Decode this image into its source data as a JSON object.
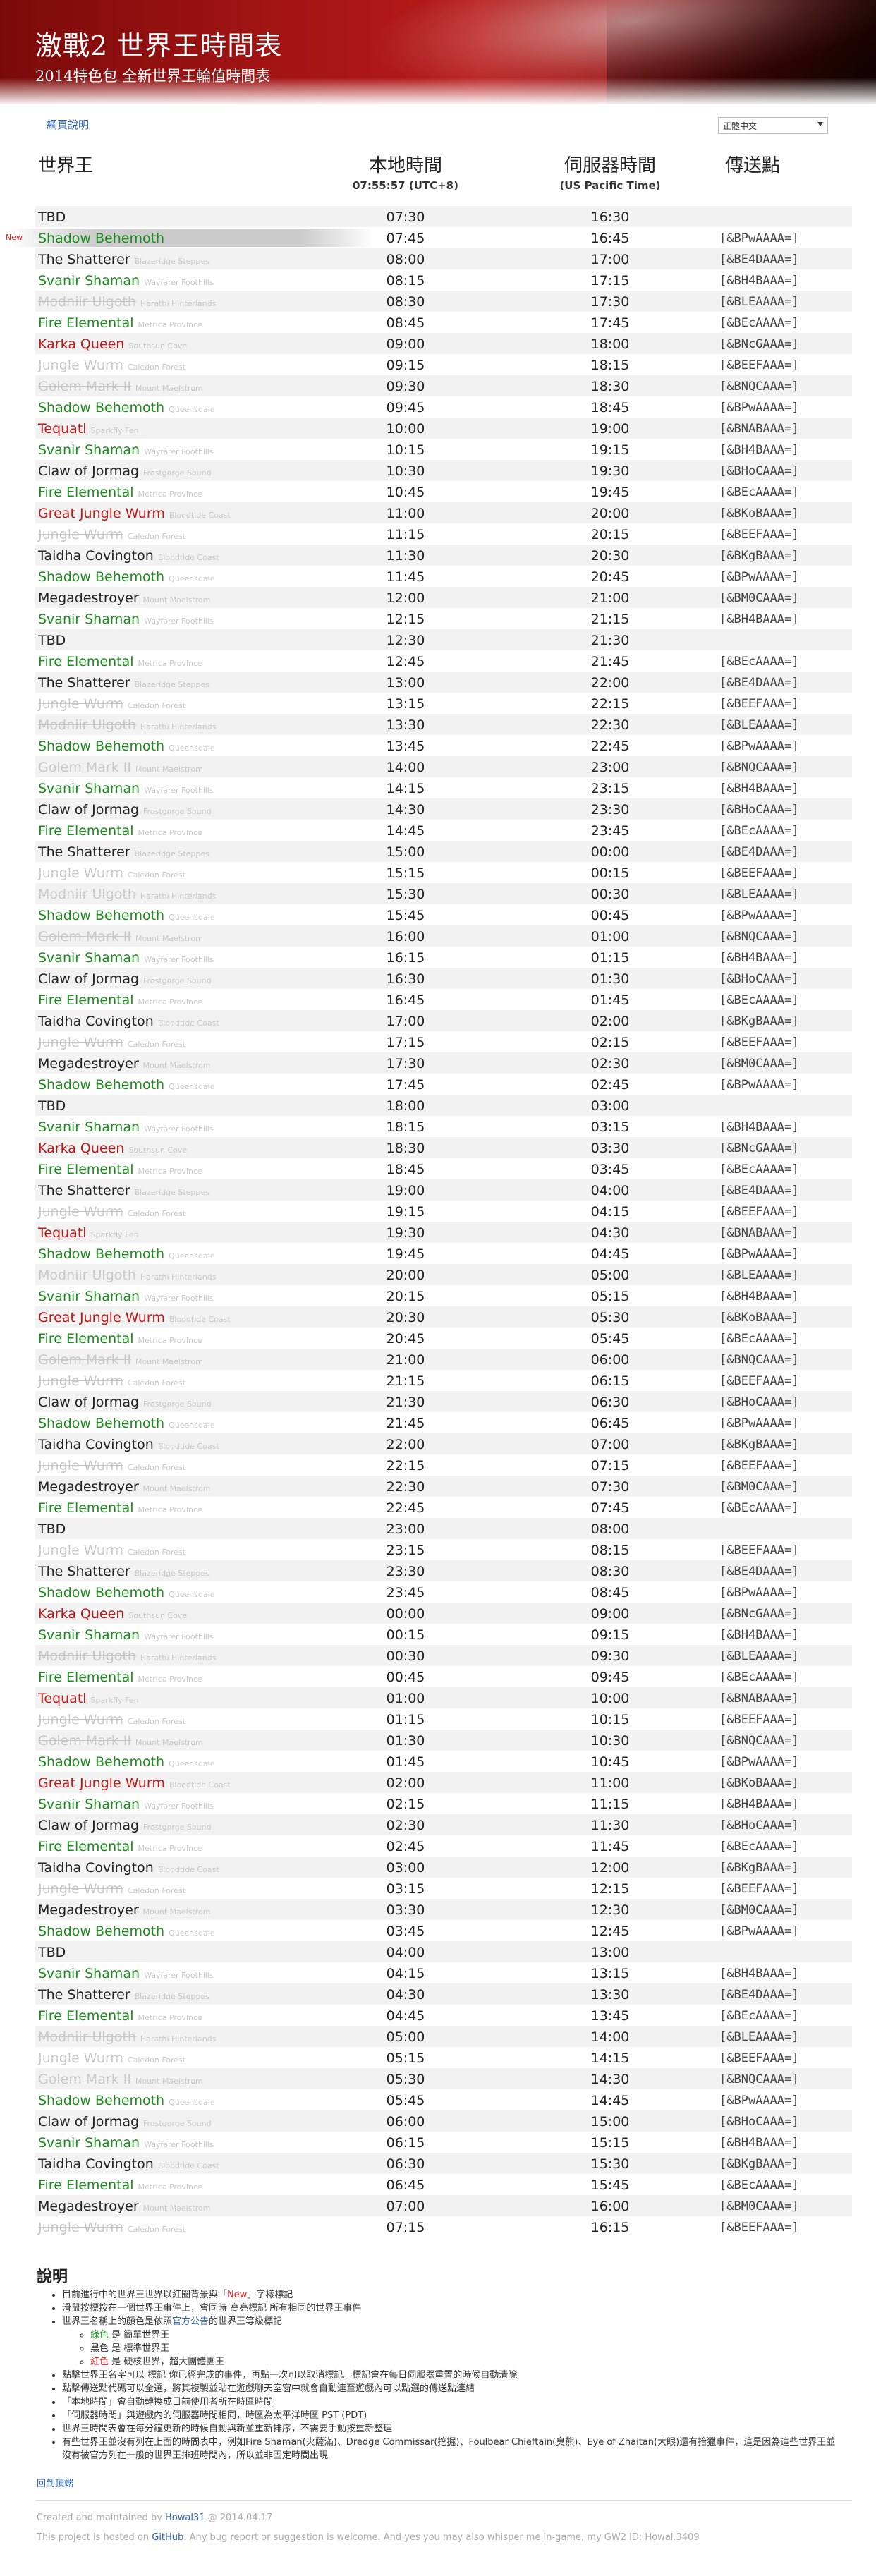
{
  "header": {
    "title": "激戰2 世界王時間表",
    "subtitle": "2014特色包 全新世界王輪值時間表"
  },
  "toolbar": {
    "help_link": "網頁說明",
    "language": "正體中文"
  },
  "columns": {
    "boss": "世界王",
    "local": "本地時間",
    "local_sub": "07:55:57 (UTC+8)",
    "server": "伺服器時間",
    "server_sub": "(US Pacific Time)",
    "waypoint": "傳送點"
  },
  "rows": [
    {
      "name": "TBD",
      "loc": "",
      "lt": "07:30",
      "st": "16:30",
      "wp": "",
      "c": "black"
    },
    {
      "name": "Shadow Behemoth",
      "loc": "",
      "lt": "07:45",
      "st": "16:45",
      "wp": "[&BPwAAAA=]",
      "c": "green",
      "new": "New"
    },
    {
      "name": "The Shatterer",
      "loc": "Blazeridge Steppes",
      "lt": "08:00",
      "st": "17:00",
      "wp": "[&BE4DAAA=]",
      "c": "black"
    },
    {
      "name": "Svanir Shaman",
      "loc": "Wayfarer Foothills",
      "lt": "08:15",
      "st": "17:15",
      "wp": "[&BH4BAAA=]",
      "c": "green"
    },
    {
      "name": "Modniir Ulgoth",
      "loc": "Harathi Hinterlands",
      "lt": "08:30",
      "st": "17:30",
      "wp": "[&BLEAAAA=]",
      "c": "gone"
    },
    {
      "name": "Fire Elemental",
      "loc": "Metrica Province",
      "lt": "08:45",
      "st": "17:45",
      "wp": "[&BEcAAAA=]",
      "c": "green"
    },
    {
      "name": "Karka Queen",
      "loc": "Southsun Cove",
      "lt": "09:00",
      "st": "18:00",
      "wp": "[&BNcGAAA=]",
      "c": "red"
    },
    {
      "name": "Jungle Wurm",
      "loc": "Caledon Forest",
      "lt": "09:15",
      "st": "18:15",
      "wp": "[&BEEFAAA=]",
      "c": "gone"
    },
    {
      "name": "Golem Mark II",
      "loc": "Mount Maelstrom",
      "lt": "09:30",
      "st": "18:30",
      "wp": "[&BNQCAAA=]",
      "c": "gone"
    },
    {
      "name": "Shadow Behemoth",
      "loc": "Queensdale",
      "lt": "09:45",
      "st": "18:45",
      "wp": "[&BPwAAAA=]",
      "c": "green"
    },
    {
      "name": "Tequatl",
      "loc": "Sparkfly Fen",
      "lt": "10:00",
      "st": "19:00",
      "wp": "[&BNABAAA=]",
      "c": "red"
    },
    {
      "name": "Svanir Shaman",
      "loc": "Wayfarer Foothills",
      "lt": "10:15",
      "st": "19:15",
      "wp": "[&BH4BAAA=]",
      "c": "green"
    },
    {
      "name": "Claw of Jormag",
      "loc": "Frostgorge Sound",
      "lt": "10:30",
      "st": "19:30",
      "wp": "[&BHoCAAA=]",
      "c": "black"
    },
    {
      "name": "Fire Elemental",
      "loc": "Metrica Province",
      "lt": "10:45",
      "st": "19:45",
      "wp": "[&BEcAAAA=]",
      "c": "green"
    },
    {
      "name": "Great Jungle Wurm",
      "loc": "Bloodtide Coast",
      "lt": "11:00",
      "st": "20:00",
      "wp": "[&BKoBAAA=]",
      "c": "red"
    },
    {
      "name": "Jungle Wurm",
      "loc": "Caledon Forest",
      "lt": "11:15",
      "st": "20:15",
      "wp": "[&BEEFAAA=]",
      "c": "gone"
    },
    {
      "name": "Taidha Covington",
      "loc": "Bloodtide Coast",
      "lt": "11:30",
      "st": "20:30",
      "wp": "[&BKgBAAA=]",
      "c": "black"
    },
    {
      "name": "Shadow Behemoth",
      "loc": "Queensdale",
      "lt": "11:45",
      "st": "20:45",
      "wp": "[&BPwAAAA=]",
      "c": "green"
    },
    {
      "name": "Megadestroyer",
      "loc": "Mount Maelstrom",
      "lt": "12:00",
      "st": "21:00",
      "wp": "[&BM0CAAA=]",
      "c": "black"
    },
    {
      "name": "Svanir Shaman",
      "loc": "Wayfarer Foothills",
      "lt": "12:15",
      "st": "21:15",
      "wp": "[&BH4BAAA=]",
      "c": "green"
    },
    {
      "name": "TBD",
      "loc": "",
      "lt": "12:30",
      "st": "21:30",
      "wp": "",
      "c": "black"
    },
    {
      "name": "Fire Elemental",
      "loc": "Metrica Province",
      "lt": "12:45",
      "st": "21:45",
      "wp": "[&BEcAAAA=]",
      "c": "green"
    },
    {
      "name": "The Shatterer",
      "loc": "Blazeridge Steppes",
      "lt": "13:00",
      "st": "22:00",
      "wp": "[&BE4DAAA=]",
      "c": "black"
    },
    {
      "name": "Jungle Wurm",
      "loc": "Caledon Forest",
      "lt": "13:15",
      "st": "22:15",
      "wp": "[&BEEFAAA=]",
      "c": "gone"
    },
    {
      "name": "Modniir Ulgoth",
      "loc": "Harathi Hinterlands",
      "lt": "13:30",
      "st": "22:30",
      "wp": "[&BLEAAAA=]",
      "c": "gone"
    },
    {
      "name": "Shadow Behemoth",
      "loc": "Queensdale",
      "lt": "13:45",
      "st": "22:45",
      "wp": "[&BPwAAAA=]",
      "c": "green"
    },
    {
      "name": "Golem Mark II",
      "loc": "Mount Maelstrom",
      "lt": "14:00",
      "st": "23:00",
      "wp": "[&BNQCAAA=]",
      "c": "gone"
    },
    {
      "name": "Svanir Shaman",
      "loc": "Wayfarer Foothills",
      "lt": "14:15",
      "st": "23:15",
      "wp": "[&BH4BAAA=]",
      "c": "green"
    },
    {
      "name": "Claw of Jormag",
      "loc": "Frostgorge Sound",
      "lt": "14:30",
      "st": "23:30",
      "wp": "[&BHoCAAA=]",
      "c": "black"
    },
    {
      "name": "Fire Elemental",
      "loc": "Metrica Province",
      "lt": "14:45",
      "st": "23:45",
      "wp": "[&BEcAAAA=]",
      "c": "green"
    },
    {
      "name": "The Shatterer",
      "loc": "Blazeridge Steppes",
      "lt": "15:00",
      "st": "00:00",
      "wp": "[&BE4DAAA=]",
      "c": "black"
    },
    {
      "name": "Jungle Wurm",
      "loc": "Caledon Forest",
      "lt": "15:15",
      "st": "00:15",
      "wp": "[&BEEFAAA=]",
      "c": "gone"
    },
    {
      "name": "Modniir Ulgoth",
      "loc": "Harathi Hinterlands",
      "lt": "15:30",
      "st": "00:30",
      "wp": "[&BLEAAAA=]",
      "c": "gone"
    },
    {
      "name": "Shadow Behemoth",
      "loc": "Queensdale",
      "lt": "15:45",
      "st": "00:45",
      "wp": "[&BPwAAAA=]",
      "c": "green"
    },
    {
      "name": "Golem Mark II",
      "loc": "Mount Maelstrom",
      "lt": "16:00",
      "st": "01:00",
      "wp": "[&BNQCAAA=]",
      "c": "gone"
    },
    {
      "name": "Svanir Shaman",
      "loc": "Wayfarer Foothills",
      "lt": "16:15",
      "st": "01:15",
      "wp": "[&BH4BAAA=]",
      "c": "green"
    },
    {
      "name": "Claw of Jormag",
      "loc": "Frostgorge Sound",
      "lt": "16:30",
      "st": "01:30",
      "wp": "[&BHoCAAA=]",
      "c": "black"
    },
    {
      "name": "Fire Elemental",
      "loc": "Metrica Province",
      "lt": "16:45",
      "st": "01:45",
      "wp": "[&BEcAAAA=]",
      "c": "green"
    },
    {
      "name": "Taidha Covington",
      "loc": "Bloodtide Coast",
      "lt": "17:00",
      "st": "02:00",
      "wp": "[&BKgBAAA=]",
      "c": "black"
    },
    {
      "name": "Jungle Wurm",
      "loc": "Caledon Forest",
      "lt": "17:15",
      "st": "02:15",
      "wp": "[&BEEFAAA=]",
      "c": "gone"
    },
    {
      "name": "Megadestroyer",
      "loc": "Mount Maelstrom",
      "lt": "17:30",
      "st": "02:30",
      "wp": "[&BM0CAAA=]",
      "c": "black"
    },
    {
      "name": "Shadow Behemoth",
      "loc": "Queensdale",
      "lt": "17:45",
      "st": "02:45",
      "wp": "[&BPwAAAA=]",
      "c": "green"
    },
    {
      "name": "TBD",
      "loc": "",
      "lt": "18:00",
      "st": "03:00",
      "wp": "",
      "c": "black"
    },
    {
      "name": "Svanir Shaman",
      "loc": "Wayfarer Foothills",
      "lt": "18:15",
      "st": "03:15",
      "wp": "[&BH4BAAA=]",
      "c": "green"
    },
    {
      "name": "Karka Queen",
      "loc": "Southsun Cove",
      "lt": "18:30",
      "st": "03:30",
      "wp": "[&BNcGAAA=]",
      "c": "red"
    },
    {
      "name": "Fire Elemental",
      "loc": "Metrica Province",
      "lt": "18:45",
      "st": "03:45",
      "wp": "[&BEcAAAA=]",
      "c": "green"
    },
    {
      "name": "The Shatterer",
      "loc": "Blazeridge Steppes",
      "lt": "19:00",
      "st": "04:00",
      "wp": "[&BE4DAAA=]",
      "c": "black"
    },
    {
      "name": "Jungle Wurm",
      "loc": "Caledon Forest",
      "lt": "19:15",
      "st": "04:15",
      "wp": "[&BEEFAAA=]",
      "c": "gone"
    },
    {
      "name": "Tequatl",
      "loc": "Sparkfly Fen",
      "lt": "19:30",
      "st": "04:30",
      "wp": "[&BNABAAA=]",
      "c": "red"
    },
    {
      "name": "Shadow Behemoth",
      "loc": "Queensdale",
      "lt": "19:45",
      "st": "04:45",
      "wp": "[&BPwAAAA=]",
      "c": "green"
    },
    {
      "name": "Modniir Ulgoth",
      "loc": "Harathi Hinterlands",
      "lt": "20:00",
      "st": "05:00",
      "wp": "[&BLEAAAA=]",
      "c": "gone"
    },
    {
      "name": "Svanir Shaman",
      "loc": "Wayfarer Foothills",
      "lt": "20:15",
      "st": "05:15",
      "wp": "[&BH4BAAA=]",
      "c": "green"
    },
    {
      "name": "Great Jungle Wurm",
      "loc": "Bloodtide Coast",
      "lt": "20:30",
      "st": "05:30",
      "wp": "[&BKoBAAA=]",
      "c": "red"
    },
    {
      "name": "Fire Elemental",
      "loc": "Metrica Province",
      "lt": "20:45",
      "st": "05:45",
      "wp": "[&BEcAAAA=]",
      "c": "green"
    },
    {
      "name": "Golem Mark II",
      "loc": "Mount Maelstrom",
      "lt": "21:00",
      "st": "06:00",
      "wp": "[&BNQCAAA=]",
      "c": "gone"
    },
    {
      "name": "Jungle Wurm",
      "loc": "Caledon Forest",
      "lt": "21:15",
      "st": "06:15",
      "wp": "[&BEEFAAA=]",
      "c": "gone"
    },
    {
      "name": "Claw of Jormag",
      "loc": "Frostgorge Sound",
      "lt": "21:30",
      "st": "06:30",
      "wp": "[&BHoCAAA=]",
      "c": "black"
    },
    {
      "name": "Shadow Behemoth",
      "loc": "Queensdale",
      "lt": "21:45",
      "st": "06:45",
      "wp": "[&BPwAAAA=]",
      "c": "green"
    },
    {
      "name": "Taidha Covington",
      "loc": "Bloodtide Coast",
      "lt": "22:00",
      "st": "07:00",
      "wp": "[&BKgBAAA=]",
      "c": "black"
    },
    {
      "name": "Jungle Wurm",
      "loc": "Caledon Forest",
      "lt": "22:15",
      "st": "07:15",
      "wp": "[&BEEFAAA=]",
      "c": "gone"
    },
    {
      "name": "Megadestroyer",
      "loc": "Mount Maelstrom",
      "lt": "22:30",
      "st": "07:30",
      "wp": "[&BM0CAAA=]",
      "c": "black"
    },
    {
      "name": "Fire Elemental",
      "loc": "Metrica Province",
      "lt": "22:45",
      "st": "07:45",
      "wp": "[&BEcAAAA=]",
      "c": "green"
    },
    {
      "name": "TBD",
      "loc": "",
      "lt": "23:00",
      "st": "08:00",
      "wp": "",
      "c": "black"
    },
    {
      "name": "Jungle Wurm",
      "loc": "Caledon Forest",
      "lt": "23:15",
      "st": "08:15",
      "wp": "[&BEEFAAA=]",
      "c": "gone"
    },
    {
      "name": "The Shatterer",
      "loc": "Blazeridge Steppes",
      "lt": "23:30",
      "st": "08:30",
      "wp": "[&BE4DAAA=]",
      "c": "black"
    },
    {
      "name": "Shadow Behemoth",
      "loc": "Queensdale",
      "lt": "23:45",
      "st": "08:45",
      "wp": "[&BPwAAAA=]",
      "c": "green"
    },
    {
      "name": "Karka Queen",
      "loc": "Southsun Cove",
      "lt": "00:00",
      "st": "09:00",
      "wp": "[&BNcGAAA=]",
      "c": "red"
    },
    {
      "name": "Svanir Shaman",
      "loc": "Wayfarer Foothills",
      "lt": "00:15",
      "st": "09:15",
      "wp": "[&BH4BAAA=]",
      "c": "green"
    },
    {
      "name": "Modniir Ulgoth",
      "loc": "Harathi Hinterlands",
      "lt": "00:30",
      "st": "09:30",
      "wp": "[&BLEAAAA=]",
      "c": "gone"
    },
    {
      "name": "Fire Elemental",
      "loc": "Metrica Province",
      "lt": "00:45",
      "st": "09:45",
      "wp": "[&BEcAAAA=]",
      "c": "green"
    },
    {
      "name": "Tequatl",
      "loc": "Sparkfly Fen",
      "lt": "01:00",
      "st": "10:00",
      "wp": "[&BNABAAA=]",
      "c": "red"
    },
    {
      "name": "Jungle Wurm",
      "loc": "Caledon Forest",
      "lt": "01:15",
      "st": "10:15",
      "wp": "[&BEEFAAA=]",
      "c": "gone"
    },
    {
      "name": "Golem Mark II",
      "loc": "Mount Maelstrom",
      "lt": "01:30",
      "st": "10:30",
      "wp": "[&BNQCAAA=]",
      "c": "gone"
    },
    {
      "name": "Shadow Behemoth",
      "loc": "Queensdale",
      "lt": "01:45",
      "st": "10:45",
      "wp": "[&BPwAAAA=]",
      "c": "green"
    },
    {
      "name": "Great Jungle Wurm",
      "loc": "Bloodtide Coast",
      "lt": "02:00",
      "st": "11:00",
      "wp": "[&BKoBAAA=]",
      "c": "red"
    },
    {
      "name": "Svanir Shaman",
      "loc": "Wayfarer Foothills",
      "lt": "02:15",
      "st": "11:15",
      "wp": "[&BH4BAAA=]",
      "c": "green"
    },
    {
      "name": "Claw of Jormag",
      "loc": "Frostgorge Sound",
      "lt": "02:30",
      "st": "11:30",
      "wp": "[&BHoCAAA=]",
      "c": "black"
    },
    {
      "name": "Fire Elemental",
      "loc": "Metrica Province",
      "lt": "02:45",
      "st": "11:45",
      "wp": "[&BEcAAAA=]",
      "c": "green"
    },
    {
      "name": "Taidha Covington",
      "loc": "Bloodtide Coast",
      "lt": "03:00",
      "st": "12:00",
      "wp": "[&BKgBAAA=]",
      "c": "black"
    },
    {
      "name": "Jungle Wurm",
      "loc": "Caledon Forest",
      "lt": "03:15",
      "st": "12:15",
      "wp": "[&BEEFAAA=]",
      "c": "gone"
    },
    {
      "name": "Megadestroyer",
      "loc": "Mount Maelstrom",
      "lt": "03:30",
      "st": "12:30",
      "wp": "[&BM0CAAA=]",
      "c": "black"
    },
    {
      "name": "Shadow Behemoth",
      "loc": "Queensdale",
      "lt": "03:45",
      "st": "12:45",
      "wp": "[&BPwAAAA=]",
      "c": "green"
    },
    {
      "name": "TBD",
      "loc": "",
      "lt": "04:00",
      "st": "13:00",
      "wp": "",
      "c": "black"
    },
    {
      "name": "Svanir Shaman",
      "loc": "Wayfarer Foothills",
      "lt": "04:15",
      "st": "13:15",
      "wp": "[&BH4BAAA=]",
      "c": "green"
    },
    {
      "name": "The Shatterer",
      "loc": "Blazeridge Steppes",
      "lt": "04:30",
      "st": "13:30",
      "wp": "[&BE4DAAA=]",
      "c": "black"
    },
    {
      "name": "Fire Elemental",
      "loc": "Metrica Province",
      "lt": "04:45",
      "st": "13:45",
      "wp": "[&BEcAAAA=]",
      "c": "green"
    },
    {
      "name": "Modniir Ulgoth",
      "loc": "Harathi Hinterlands",
      "lt": "05:00",
      "st": "14:00",
      "wp": "[&BLEAAAA=]",
      "c": "gone"
    },
    {
      "name": "Jungle Wurm",
      "loc": "Caledon Forest",
      "lt": "05:15",
      "st": "14:15",
      "wp": "[&BEEFAAA=]",
      "c": "gone"
    },
    {
      "name": "Golem Mark II",
      "loc": "Mount Maelstrom",
      "lt": "05:30",
      "st": "14:30",
      "wp": "[&BNQCAAA=]",
      "c": "gone"
    },
    {
      "name": "Shadow Behemoth",
      "loc": "Queensdale",
      "lt": "05:45",
      "st": "14:45",
      "wp": "[&BPwAAAA=]",
      "c": "green"
    },
    {
      "name": "Claw of Jormag",
      "loc": "Frostgorge Sound",
      "lt": "06:00",
      "st": "15:00",
      "wp": "[&BHoCAAA=]",
      "c": "black"
    },
    {
      "name": "Svanir Shaman",
      "loc": "Wayfarer Foothills",
      "lt": "06:15",
      "st": "15:15",
      "wp": "[&BH4BAAA=]",
      "c": "green"
    },
    {
      "name": "Taidha Covington",
      "loc": "Bloodtide Coast",
      "lt": "06:30",
      "st": "15:30",
      "wp": "[&BKgBAAA=]",
      "c": "black"
    },
    {
      "name": "Fire Elemental",
      "loc": "Metrica Province",
      "lt": "06:45",
      "st": "15:45",
      "wp": "[&BEcAAAA=]",
      "c": "green"
    },
    {
      "name": "Megadestroyer",
      "loc": "Mount Maelstrom",
      "lt": "07:00",
      "st": "16:00",
      "wp": "[&BM0CAAA=]",
      "c": "black"
    },
    {
      "name": "Jungle Wurm",
      "loc": "Caledon Forest",
      "lt": "07:15",
      "st": "16:15",
      "wp": "[&BEEFAAA=]",
      "c": "gone"
    }
  ],
  "notes": {
    "title": "說明",
    "n1_pre": "目前進行中的世界王世界以紅圈背景與「",
    "n1_new": "New",
    "n1_post": "」字樣標記",
    "n2": "滑鼠按標按在一個世界王事件上，會同時 高亮標記 所有相同的世界王事件",
    "n3_pre": "世界王名稱上的顏色是依照",
    "n3_link": "官方公告",
    "n3_post": "的世界王等級標記",
    "s1_color": "綠色",
    "s1_text": " 是 簡單世界王",
    "s2_color": "黑色",
    "s2_text": " 是 標準世界王",
    "s3_color": "紅色",
    "s3_text": " 是 硬核世界，超大團體團王",
    "n4": "點擊世界王名字可以 標記 你已經完成的事件，再點一次可以取消標記。標記會在每日伺服器重置的時候自動清除",
    "n5": "點擊傳送點代碼可以全選，將其複製並貼在遊戲聊天室窗中就會自動連至遊戲內可以點選的傳送點連結",
    "n6": "「本地時間」會自動轉換成目前使用者所在時區時間",
    "n7": "「伺服器時間」與遊戲內的伺服器時間相同，時區為太平洋時區 PST (PDT)",
    "n8": "世界王時間表會在每分鐘更新的時候自動與新並重新排序，不需要手動按重新整理",
    "n9": "有些世界王並沒有列在上面的時間表中，例如Fire Shaman(火薩滿)、Dredge Commissar(挖掘)、Foulbear Chieftain(臭熊)、Eye of Zhaitan(大眼)還有拾獵事件，這是因為這些世界王並沒有被官方列在一般的世界王排班時間內，所以並非固定時間出現",
    "back_top": "回到頂端"
  },
  "footer": {
    "line1_pre": "Created and maintained by ",
    "line1_link": "Howal31",
    "line1_post": " @ 2014.04.17",
    "line2_pre": "This project is hosted on ",
    "line2_link": "GitHub",
    "line2_post": ". Any bug report or suggestion is welcome. And yes you may also whisper me in-game, my GW2 ID: Howal.3409"
  },
  "colors": {
    "easy": "#1c8c1c",
    "standard": "#222222",
    "hardcore": "#c01818",
    "inactive": "#c8c8c8",
    "link": "#2a62b6"
  }
}
